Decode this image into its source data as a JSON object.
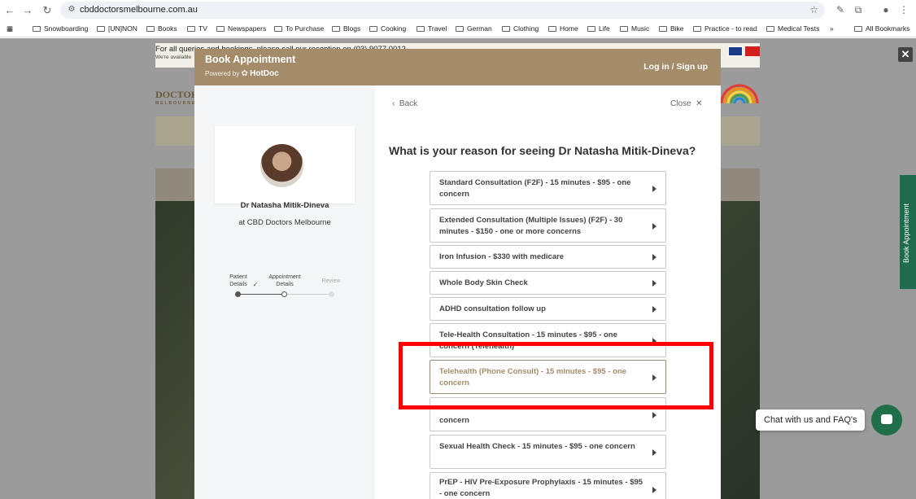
{
  "browser": {
    "url": "cbddoctorsmelbourne.com.au",
    "bookmarks": [
      "Snowboarding",
      "[UN]NON",
      "Books",
      "TV",
      "Newspapers",
      "To Purchase",
      "Blogs",
      "Cooking",
      "Travel",
      "German",
      "Clothing",
      "Home",
      "Life",
      "Music",
      "Bike",
      "Practice - to read",
      "Medical Tests"
    ],
    "all_bookmarks": "All Bookmarks"
  },
  "site": {
    "topbar_text": "For all queries and bookings, please call our reception on (03) 9077 0012",
    "topbar_sub": "We're available",
    "logo_text": "DOCTORS",
    "logo_sub": "MELBOURNE",
    "side_tab": "Book Appointment",
    "chat_label": "Chat with us and FAQ's"
  },
  "modal": {
    "title": "Book Appointment",
    "powered_by": "Powered by",
    "powered_brand": "HotDoc",
    "login": "Log in / Sign up",
    "back": "Back",
    "close": "Close",
    "doctor_name": "Dr Natasha Mitik-Dineva",
    "doctor_at_prefix": "at",
    "doctor_clinic": "CBD Doctors Melbourne",
    "steps": [
      {
        "label": "Patient Details",
        "state": "done"
      },
      {
        "label": "Appointment Details",
        "state": "current"
      },
      {
        "label": "Review",
        "state": "todo"
      }
    ],
    "question": "What is your reason for seeing Dr Natasha Mitik-Dineva?",
    "options": [
      "Standard Consultation (F2F) - 15 minutes - $95 - one concern",
      "Extended Consultation (Multiple Issues) (F2F) - 30 minutes - $150 - one or more concerns",
      "Iron Infusion - $330 with medicare",
      "Whole Body Skin Check",
      "ADHD consultation follow up",
      "Tele-Health Consultation - 15 minutes - $95 - one concern (Telehealth)",
      "Telehealth (Phone Consult) - 15 minutes - $95 - one concern",
      "concern",
      "Sexual Health Check - 15 minutes - $95 - one concern",
      "PrEP - HIV Pre-Exposure Prophylaxis - 15 minutes - $95 - one concern"
    ],
    "selected_index": 6
  }
}
